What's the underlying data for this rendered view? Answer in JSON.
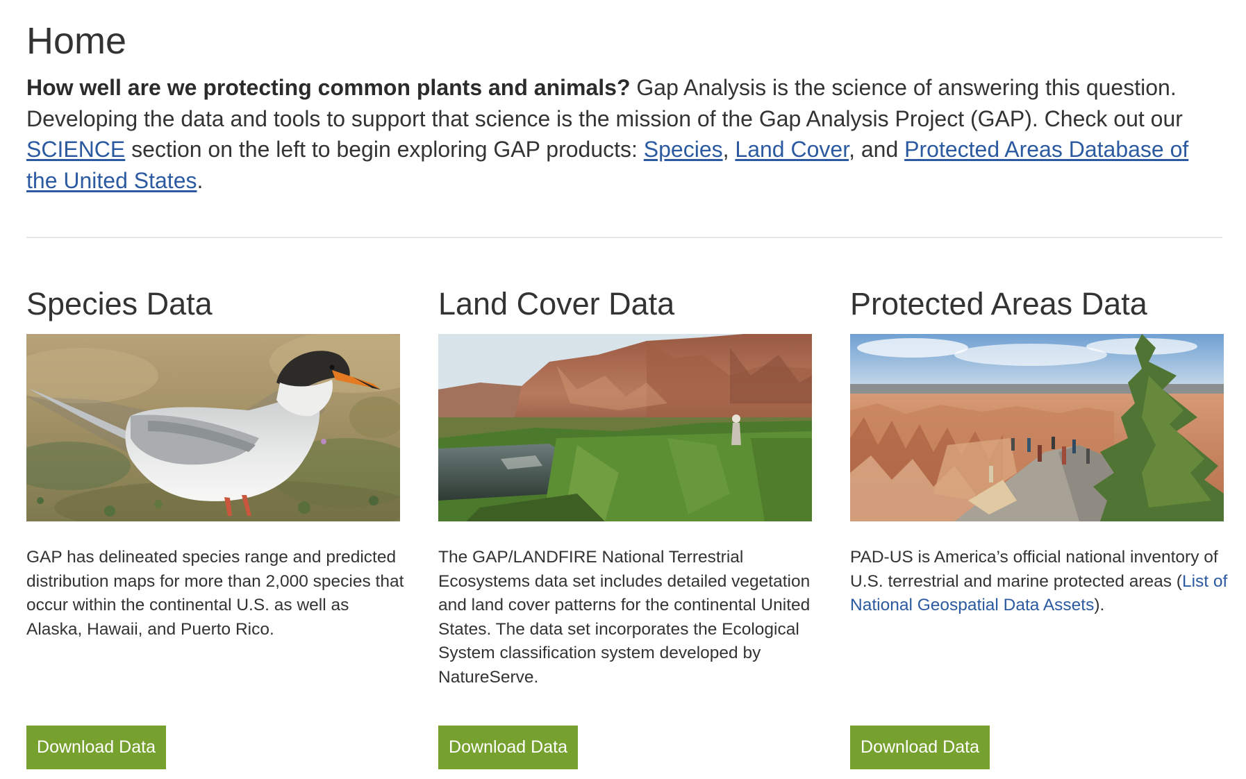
{
  "page": {
    "title": "Home"
  },
  "intro": {
    "bold_question": "How well are we protecting common plants and animals?",
    "text_1": " Gap Analysis is the science of answering this question. Developing the data and tools to support that science is the mission of the Gap Analysis Project (GAP). Check out our ",
    "link_science": "SCIENCE",
    "text_2": " section on the left to begin exploring GAP products: ",
    "link_species": "Species",
    "sep_1": ", ",
    "link_land_cover": "Land Cover",
    "sep_2": ", and ",
    "link_padus": "Protected Areas Database of the United States",
    "end": "."
  },
  "cards": [
    {
      "heading": "Species Data",
      "image_alt": "Tern standing on ground vegetation",
      "text": "GAP has delineated species range and predicted distribution maps for more than 2,000 species that occur within the continental U.S. as well as Alaska, Hawaii, and Puerto Rico.",
      "button_label": "Download Data"
    },
    {
      "heading": "Land Cover Data",
      "image_alt": "Red rock canyon wall above a marsh with a person",
      "text": "The GAP/LANDFIRE National Terrestrial Ecosystems data set includes detailed vegetation and land cover patterns for the continental United States. The data set incorporates the Ecological System classification system developed by NatureServe.",
      "button_label": "Download Data"
    },
    {
      "heading": "Protected Areas Data",
      "image_alt": "Visitors on an overlook path above hoodoo canyon",
      "text_1": "PAD-US is America’s official national inventory of U.S. terrestrial and marine protected areas (",
      "link": "List of National Geospatial Data Assets",
      "text_2": ").",
      "button_label": "Download Data"
    }
  ],
  "colors": {
    "text": "#333333",
    "link": "#2c5aa0",
    "button_bg": "#76a12f",
    "button_text": "#ffffff",
    "divider": "#e6e6e6"
  }
}
